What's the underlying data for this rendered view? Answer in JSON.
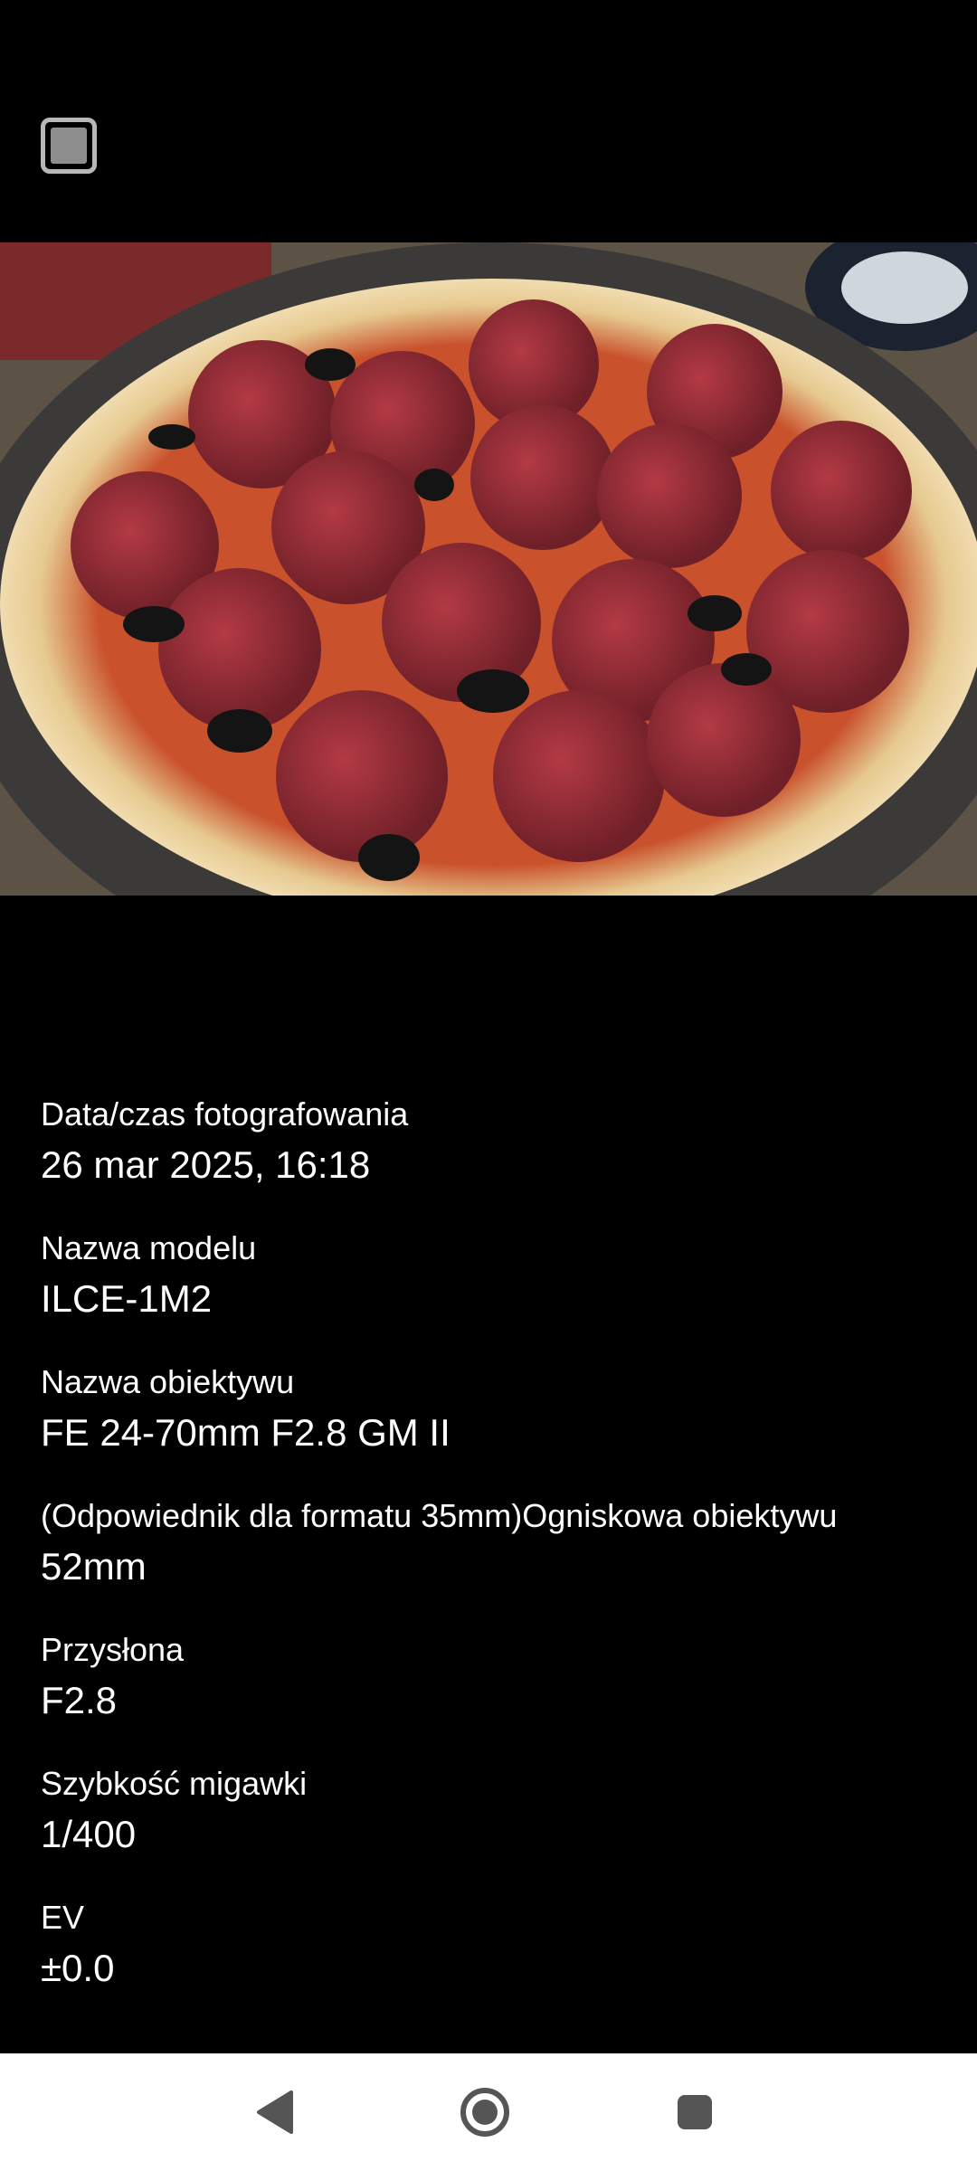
{
  "toolbar": {
    "select_icon": "checkbox-icon"
  },
  "photo": {
    "subject": "pizza-photo"
  },
  "exif": [
    {
      "label": "Data/czas fotografowania",
      "value": "26 mar 2025, 16:18"
    },
    {
      "label": "Nazwa modelu",
      "value": "ILCE-1M2"
    },
    {
      "label": "Nazwa obiektywu",
      "value": "FE 24-70mm F2.8 GM II"
    },
    {
      "label": "(Odpowiednik dla formatu 35mm)Ogniskowa obiektywu",
      "value": "52mm"
    },
    {
      "label": "Przysłona",
      "value": "F2.8"
    },
    {
      "label": "Szybkość migawki",
      "value": "1/400"
    },
    {
      "label": "EV",
      "value": "±0.0"
    }
  ],
  "navigation": {
    "back_icon": "back-triangle-icon",
    "home_icon": "home-circle-icon",
    "recent_icon": "recent-square-icon"
  },
  "colors": {
    "background": "#000000",
    "nav_background": "#ffffff",
    "nav_icon": "#555555"
  }
}
